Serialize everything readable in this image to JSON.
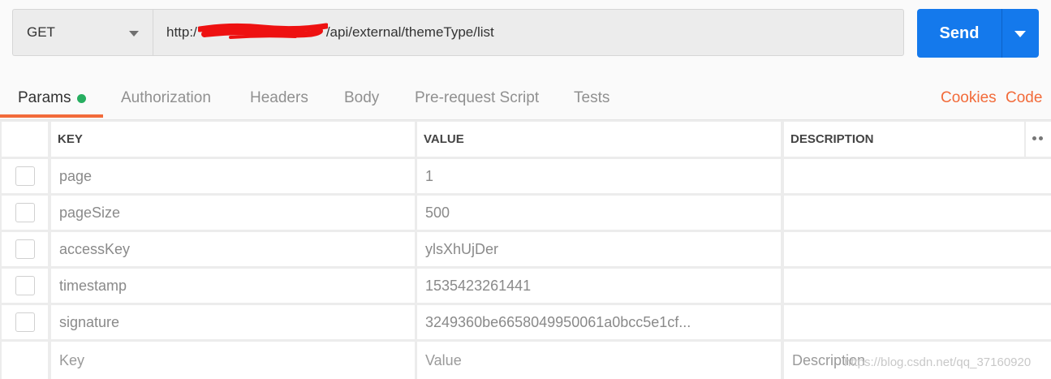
{
  "request": {
    "method": "GET",
    "url_prefix": "http:/",
    "url_suffix": "/api/external/themeType/list",
    "send_label": "Send"
  },
  "tabs": {
    "items": [
      "Params",
      "Authorization",
      "Headers",
      "Body",
      "Pre-request Script",
      "Tests"
    ],
    "active": "Params",
    "cookies_label": "Cookies",
    "code_label": "Code"
  },
  "params": {
    "columns": [
      "KEY",
      "VALUE",
      "DESCRIPTION"
    ],
    "rows": [
      {
        "key": "page",
        "value": "1",
        "description": ""
      },
      {
        "key": "pageSize",
        "value": "500",
        "description": ""
      },
      {
        "key": "accessKey",
        "value": "ylsXhUjDer",
        "description": ""
      },
      {
        "key": "timestamp",
        "value": "1535423261441",
        "description": ""
      },
      {
        "key": "signature",
        "value": "3249360be6658049950061a0bcc5e1cf...",
        "description": ""
      }
    ],
    "placeholders": {
      "key": "Key",
      "value": "Value",
      "description": "Description"
    }
  },
  "watermark": "https://blog.csdn.net/qq_37160920",
  "colors": {
    "accent_orange": "#f26b3a",
    "send_blue": "#1479ec",
    "params_dot_green": "#27ae60"
  },
  "icons": [
    "chevron-down-icon",
    "more-horizontal-icon",
    "status-dot-icon"
  ]
}
